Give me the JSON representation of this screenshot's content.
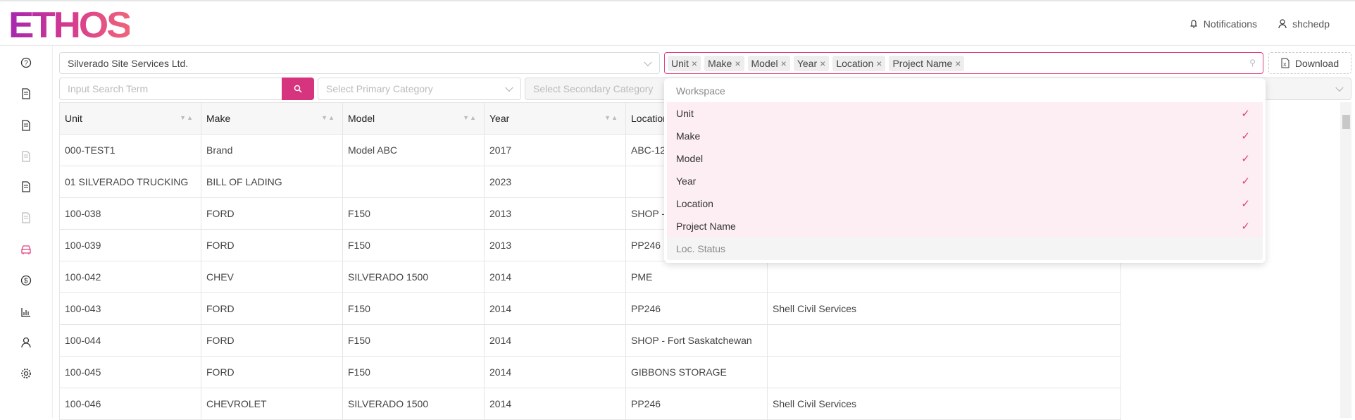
{
  "brand": "ETHOS",
  "header": {
    "notifications": "Notifications",
    "user": "shchedp"
  },
  "sidebar": [
    "help-icon",
    "document-alert-icon",
    "server-icon",
    "inbox-icon",
    "document-check-icon",
    "document-user-icon",
    "car-icon",
    "dollar-icon",
    "chart-icon",
    "user-icon",
    "gear-icon"
  ],
  "accent": "#e0407f",
  "filters": {
    "company": "Silverado Site Services Ltd.",
    "search_placeholder": "Input Search Term",
    "primary_placeholder": "Select Primary Category",
    "secondary_placeholder": "Select Secondary Category",
    "download": "Download"
  },
  "tags": [
    "Unit",
    "Make",
    "Model",
    "Year",
    "Location",
    "Project Name"
  ],
  "dropdown": {
    "group": "Workspace",
    "items": [
      {
        "label": "Unit",
        "selected": true
      },
      {
        "label": "Make",
        "selected": true
      },
      {
        "label": "Model",
        "selected": true
      },
      {
        "label": "Year",
        "selected": true
      },
      {
        "label": "Location",
        "selected": true
      },
      {
        "label": "Project Name",
        "selected": true
      },
      {
        "label": "Loc. Status",
        "selected": false
      }
    ]
  },
  "table": {
    "headers": [
      "Unit",
      "Make",
      "Model",
      "Year",
      "Location",
      ""
    ],
    "rows": [
      [
        "000-TEST1",
        "Brand",
        "Model ABC",
        "2017",
        "ABC-12",
        ""
      ],
      [
        "01 SILVERADO TRUCKING",
        "BILL OF LADING",
        "",
        "2023",
        "",
        ""
      ],
      [
        "100-038",
        "FORD",
        "F150",
        "2013",
        "SHOP -",
        ""
      ],
      [
        "100-039",
        "FORD",
        "F150",
        "2013",
        "PP246",
        ""
      ],
      [
        "100-042",
        "CHEV",
        "SILVERADO 1500",
        "2014",
        "PME",
        ""
      ],
      [
        "100-043",
        "FORD",
        "F150",
        "2014",
        "PP246",
        "Shell Civil Services"
      ],
      [
        "100-044",
        "FORD",
        "F150",
        "2014",
        "SHOP - Fort Saskatchewan",
        ""
      ],
      [
        "100-045",
        "FORD",
        "F150",
        "2014",
        "GIBBONS STORAGE",
        ""
      ],
      [
        "100-046",
        "CHEVROLET",
        "SILVERADO 1500",
        "2014",
        "PP246",
        "Shell Civil Services"
      ]
    ]
  }
}
